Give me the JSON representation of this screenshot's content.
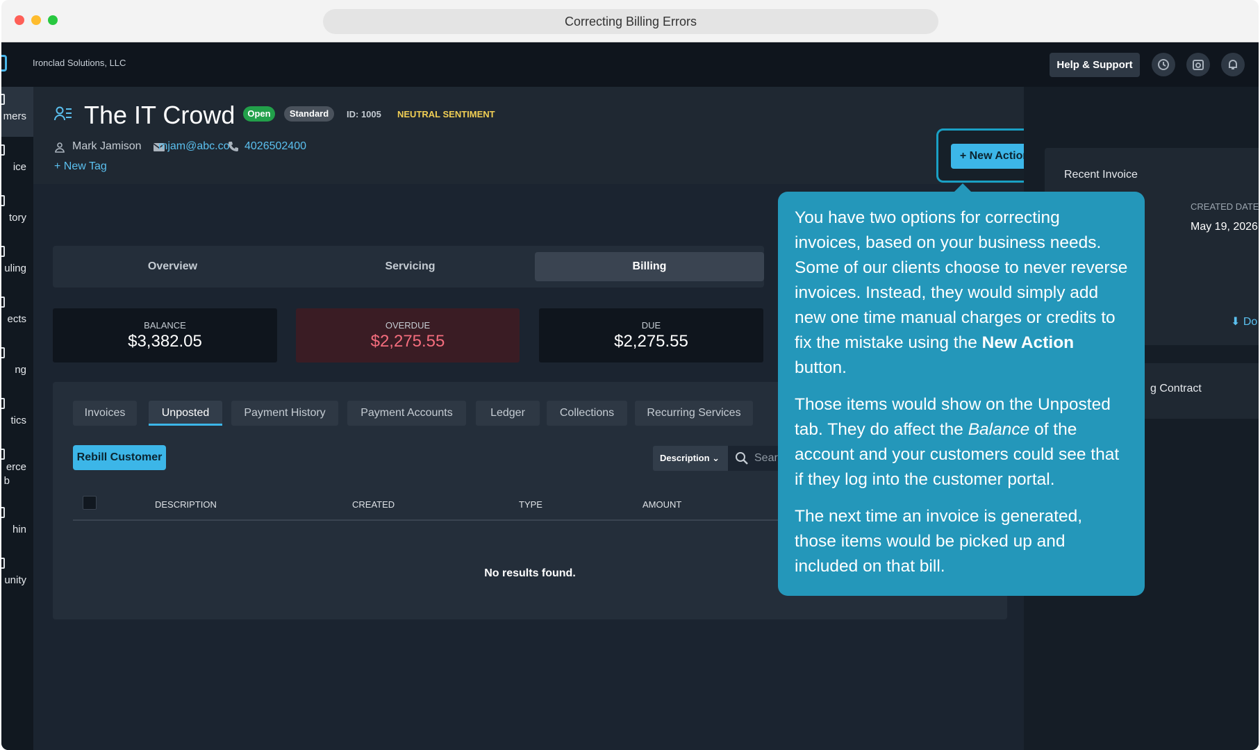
{
  "window": {
    "title": "Correcting Billing Errors"
  },
  "topbar": {
    "company": "Ironclad Solutions, LLC",
    "help_label": "Help & Support",
    "icons": [
      "history-icon",
      "camera-icon",
      "bell-icon"
    ]
  },
  "sidebar": {
    "items": [
      {
        "label": "mers",
        "active": true
      },
      {
        "label": "ice"
      },
      {
        "label": "tory"
      },
      {
        "label": "uling"
      },
      {
        "label": "ects"
      },
      {
        "label": "ng"
      },
      {
        "label": "tics"
      },
      {
        "label": "erce",
        "label2": "b"
      },
      {
        "label": "hin"
      },
      {
        "label": "unity"
      }
    ]
  },
  "customer": {
    "name": "The IT Crowd",
    "status": "Open",
    "plan": "Standard",
    "id": "ID: 1005",
    "sentiment": "NEUTRAL SENTIMENT",
    "contact_name": "Mark Jamison",
    "email": "mjam@abc.co",
    "phone": "4026502400",
    "new_tag_label": "New Tag",
    "new_action_label": "New Action"
  },
  "main_tabs": [
    {
      "label": "Overview"
    },
    {
      "label": "Servicing"
    },
    {
      "label": "Billing",
      "active": true
    }
  ],
  "stats": {
    "balance": {
      "label": "BALANCE",
      "value": "$3,382.05"
    },
    "overdue": {
      "label": "OVERDUE",
      "value": "$2,275.55"
    },
    "due": {
      "label": "DUE",
      "value": "$2,275.55"
    }
  },
  "billing": {
    "subtabs": [
      {
        "label": "Invoices"
      },
      {
        "label": "Unposted",
        "active": true
      },
      {
        "label": "Payment History"
      },
      {
        "label": "Payment Accounts"
      },
      {
        "label": "Ledger"
      },
      {
        "label": "Collections"
      },
      {
        "label": "Recurring Services"
      }
    ],
    "rebill_label": "Rebill Customer",
    "filter_select": "Description",
    "search_placeholder": "Searc",
    "columns": [
      "DESCRIPTION",
      "CREATED",
      "TYPE",
      "AMOUNT"
    ],
    "empty_text": "No results found."
  },
  "right_panel": {
    "recent_invoice_title": "Recent Invoice",
    "created_date_label": "CREATED DATE",
    "created_date": "May 19, 2026",
    "download_label": "Do",
    "contract_label": "g Contract"
  },
  "tooltip": {
    "p1_text": "You have two options for correcting invoices, based on your business needs. Some of our clients choose to never reverse invoices. Instead, they would simply add new one time manual charges or credits to fix the mistake using the ",
    "p1_bold": "New Action",
    "p1_end": " button.",
    "p2_text": "Those items would show on the Unposted tab. They do affect the ",
    "p2_italic": "Balance",
    "p2_end": " of the account and your customers could see that if they log into the customer portal.",
    "p3_text": "The next time an invoice is generated, those items would be picked up and included on that bill."
  },
  "colors": {
    "accent": "#3cb6e8",
    "tooltip_bg": "#2497ba",
    "open_badge": "#22a04a",
    "sentiment": "#f1cf54",
    "overdue_text": "#f46d7d",
    "overdue_bg": "#3a1c24"
  }
}
